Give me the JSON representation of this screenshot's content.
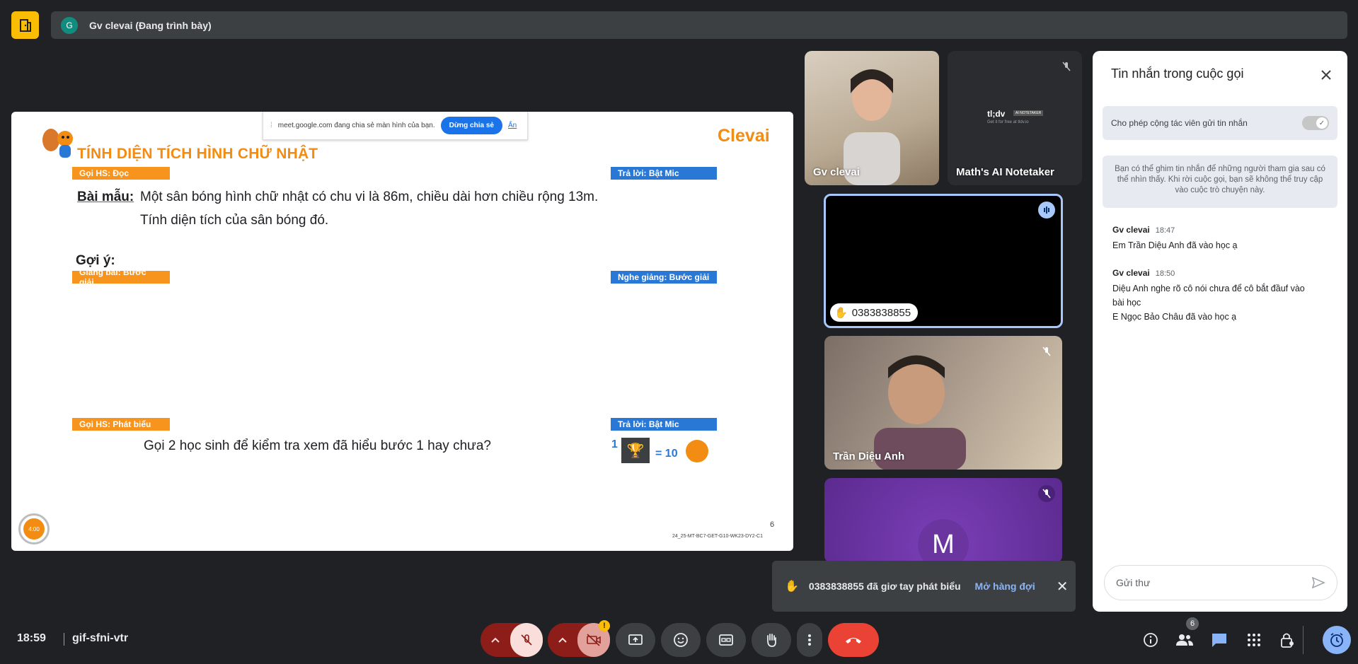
{
  "topbar": {
    "presenter_initial": "G",
    "presenter_text": "Gv clevai (Đang trình bày)"
  },
  "slide": {
    "title": "TÍNH DIỆN TÍCH HÌNH CHỮ NHẬT",
    "logo": "Clevai",
    "share_notice": "meet.google.com đang chia sẻ màn hình của bạn.",
    "share_stop": "Dừng chia sẻ",
    "share_hide": "Ẩn",
    "tag1": "Gọi HS: Đọc",
    "tag2": "Trả lời: Bật Mic",
    "sample_label": "Bài mẫu:",
    "sample_line1": "Một sân bóng hình chữ nhật có chu vi là 86m, chiều dài hơn chiều rộng 13m.",
    "sample_line2": "Tính diện tích của sân bóng đó.",
    "hint_label": "Gợi ý:",
    "tag3": "Giảng bài: Bước giải",
    "tag4": "Nghe giảng: Bước giải",
    "tag5": "Gọi HS: Phát biểu",
    "tag6": "Trả lời: Bật Mic",
    "question": "Gọi 2 học sinh để kiểm tra xem đã hiểu bước 1 hay chưa?",
    "reward_count": "1",
    "reward_value": "= 10",
    "page_number": "6",
    "slide_code": "24_25-MT-BC7-GET-G10-WK23-DY2-C1",
    "timer": "4:00"
  },
  "tiles": {
    "teacher": "Gv clevai",
    "notetaker": "Math's AI Notetaker",
    "notetaker_logo": "tl;dv",
    "notetaker_badge": "AI NOTETAKER",
    "notetaker_sub": "Get it for free at tldv.io",
    "phone": "0383838855",
    "student": "Trần Diệu Anh",
    "m_initial": "M"
  },
  "chat": {
    "title": "Tin nhắn trong cuộc gọi",
    "toggle_label": "Cho phép cộng tác viên gửi tin nhắn",
    "info": "Bạn có thể ghim tin nhắn để những người tham gia sau có thể nhìn thấy. Khi rời cuộc gọi, bạn sẽ không thể truy cập vào cuộc trò chuyện này.",
    "messages": [
      {
        "sender": "Gv clevai",
        "time": "18:47",
        "lines": [
          "Em Trần Diệu Anh đã vào học ạ"
        ]
      },
      {
        "sender": "Gv clevai",
        "time": "18:50",
        "lines": [
          "Diệu Anh nghe rõ cô nói chưa để cô bắt đầuf vào",
          "bài học",
          "E  Ngọc Bảo Châu đã vào học ạ"
        ]
      }
    ],
    "input_placeholder": "Gửi thư"
  },
  "toast": {
    "text": "0383838855 đã giơ tay phát biểu",
    "action": "Mở hàng đợi"
  },
  "bottombar": {
    "time": "18:59",
    "meeting_code": "gif-sfni-vtr",
    "participants_count": "6",
    "camera_warning": "!"
  },
  "colors": {
    "bg": "#202124",
    "accent_orange": "#f7941d",
    "accent_blue": "#2a78d6",
    "end_call": "#ea4335",
    "clevai_orange": "#f28c12"
  }
}
